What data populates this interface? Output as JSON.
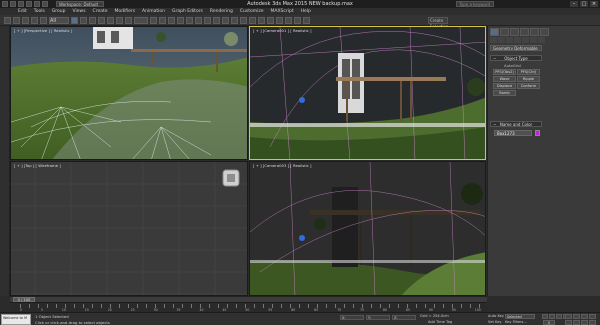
{
  "titlebar": {
    "workspace": "Workspace: Default",
    "title": "Autodesk 3ds Max  2015    NEW backup.max",
    "search_placeholder": "Type a keyword or phrase"
  },
  "menu": [
    "Edit",
    "Tools",
    "Group",
    "Views",
    "Create",
    "Modifiers",
    "Animation",
    "Graph Editors",
    "Rendering",
    "Customize",
    "MAXScript",
    "Help"
  ],
  "toolbar": {
    "selection_filter": "All",
    "named_selection_set": "Create Selection Se"
  },
  "viewports": {
    "top_left": "[ + ] [Perspective ] [ Realistic ]",
    "top_right": "[ + ] [Camera001 ] [ Realistic ]",
    "bottom_left": "[ + ] [Top ] [ Wireframe ]",
    "bottom_right": "[ + ] [Camera003 ] [ Realistic ]"
  },
  "command_panel": {
    "category": "Geometry Deformable",
    "object_type_header": "Object Type",
    "autogrid": "AutoGrid",
    "buttons": [
      "PFS(Obs2)",
      "PFS(Ctrl)",
      "Wave",
      "Ripple",
      "Displace",
      "Conform",
      "Bomb",
      ""
    ],
    "name_color_header": "Name and Color",
    "name_value": "Box1273",
    "swatch_color": "#b62ad0"
  },
  "timeline": {
    "frame_label": "0 / 100",
    "ticks": [
      "0",
      "5",
      "10",
      "15",
      "20",
      "25",
      "30",
      "35",
      "40",
      "45",
      "50",
      "55",
      "60",
      "65",
      "70",
      "75",
      "80",
      "85",
      "90",
      "95",
      "100"
    ]
  },
  "status": {
    "maxscript_text": "Welcome to M",
    "selected_text": "1 Object Selected",
    "prompt_text": "Click or click-and-drag to select objects",
    "x_label": "X:",
    "y_label": "Y:",
    "z_label": "Z:",
    "grid": "Grid = 254.0cm",
    "add_time_tag": "Add Time Tag",
    "auto_key": "Auto Key",
    "selected_mode": "Selected",
    "set_key": "Set Key",
    "key_filters": "Key Filters...",
    "frame": "0"
  }
}
